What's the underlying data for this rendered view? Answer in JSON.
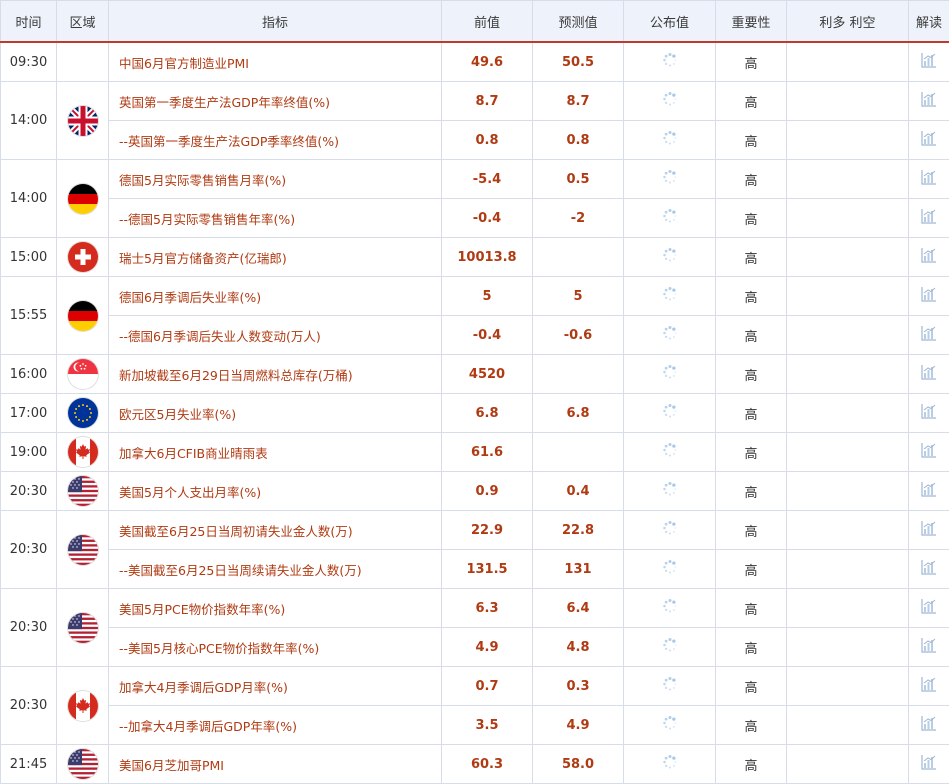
{
  "headers": {
    "time": "时间",
    "region": "区域",
    "indicator": "指标",
    "previous": "前值",
    "forecast": "预测值",
    "actual": "公布值",
    "importance": "重要性",
    "bull_bear": "利多 利空",
    "analysis": "解读"
  },
  "icons": {
    "pending": "loading-spinner-icon",
    "analysis": "bar-chart-icon"
  },
  "colors": {
    "indicator_text": "#b03a12",
    "header_bg": "#eef3fb",
    "header_border": "#c0392b"
  },
  "groups": [
    {
      "time": "09:30",
      "flag": "",
      "rows": [
        {
          "indicator": "中国6月官方制造业PMI",
          "previous": "49.6",
          "forecast": "50.5",
          "actual": "",
          "importance": "高"
        }
      ]
    },
    {
      "time": "14:00",
      "flag": "uk",
      "rows": [
        {
          "indicator": "英国第一季度生产法GDP年率终值(%)",
          "previous": "8.7",
          "forecast": "8.7",
          "actual": "",
          "importance": "高"
        },
        {
          "indicator": "--英国第一季度生产法GDP季率终值(%)",
          "previous": "0.8",
          "forecast": "0.8",
          "actual": "",
          "importance": "高"
        }
      ]
    },
    {
      "time": "14:00",
      "flag": "de",
      "rows": [
        {
          "indicator": "德国5月实际零售销售月率(%)",
          "previous": "-5.4",
          "forecast": "0.5",
          "actual": "",
          "importance": "高"
        },
        {
          "indicator": "--德国5月实际零售销售年率(%)",
          "previous": "-0.4",
          "forecast": "-2",
          "actual": "",
          "importance": "高"
        }
      ]
    },
    {
      "time": "15:00",
      "flag": "ch",
      "rows": [
        {
          "indicator": "瑞士5月官方储备资产(亿瑞郎)",
          "previous": "10013.8",
          "forecast": "",
          "actual": "",
          "importance": "高"
        }
      ]
    },
    {
      "time": "15:55",
      "flag": "de",
      "rows": [
        {
          "indicator": "德国6月季调后失业率(%)",
          "previous": "5",
          "forecast": "5",
          "actual": "",
          "importance": "高"
        },
        {
          "indicator": "--德国6月季调后失业人数变动(万人)",
          "previous": "-0.4",
          "forecast": "-0.6",
          "actual": "",
          "importance": "高"
        }
      ]
    },
    {
      "time": "16:00",
      "flag": "sg",
      "rows": [
        {
          "indicator": "新加坡截至6月29日当周燃料总库存(万桶)",
          "previous": "4520",
          "forecast": "",
          "actual": "",
          "importance": "高"
        }
      ]
    },
    {
      "time": "17:00",
      "flag": "eu",
      "rows": [
        {
          "indicator": "欧元区5月失业率(%)",
          "previous": "6.8",
          "forecast": "6.8",
          "actual": "",
          "importance": "高"
        }
      ]
    },
    {
      "time": "19:00",
      "flag": "ca",
      "rows": [
        {
          "indicator": "加拿大6月CFIB商业晴雨表",
          "previous": "61.6",
          "forecast": "",
          "actual": "",
          "importance": "高"
        }
      ]
    },
    {
      "time": "20:30",
      "flag": "us",
      "rows": [
        {
          "indicator": "美国5月个人支出月率(%)",
          "previous": "0.9",
          "forecast": "0.4",
          "actual": "",
          "importance": "高"
        }
      ]
    },
    {
      "time": "20:30",
      "flag": "us",
      "rows": [
        {
          "indicator": "美国截至6月25日当周初请失业金人数(万)",
          "previous": "22.9",
          "forecast": "22.8",
          "actual": "",
          "importance": "高"
        },
        {
          "indicator": "--美国截至6月25日当周续请失业金人数(万)",
          "previous": "131.5",
          "forecast": "131",
          "actual": "",
          "importance": "高"
        }
      ]
    },
    {
      "time": "20:30",
      "flag": "us",
      "rows": [
        {
          "indicator": "美国5月PCE物价指数年率(%)",
          "previous": "6.3",
          "forecast": "6.4",
          "actual": "",
          "importance": "高"
        },
        {
          "indicator": "--美国5月核心PCE物价指数年率(%)",
          "previous": "4.9",
          "forecast": "4.8",
          "actual": "",
          "importance": "高"
        }
      ]
    },
    {
      "time": "20:30",
      "flag": "ca",
      "rows": [
        {
          "indicator": "加拿大4月季调后GDP月率(%)",
          "previous": "0.7",
          "forecast": "0.3",
          "actual": "",
          "importance": "高"
        },
        {
          "indicator": "--加拿大4月季调后GDP年率(%)",
          "previous": "3.5",
          "forecast": "4.9",
          "actual": "",
          "importance": "高"
        }
      ]
    },
    {
      "time": "21:45",
      "flag": "us",
      "rows": [
        {
          "indicator": "美国6月芝加哥PMI",
          "previous": "60.3",
          "forecast": "58.0",
          "actual": "",
          "importance": "高"
        }
      ]
    }
  ]
}
